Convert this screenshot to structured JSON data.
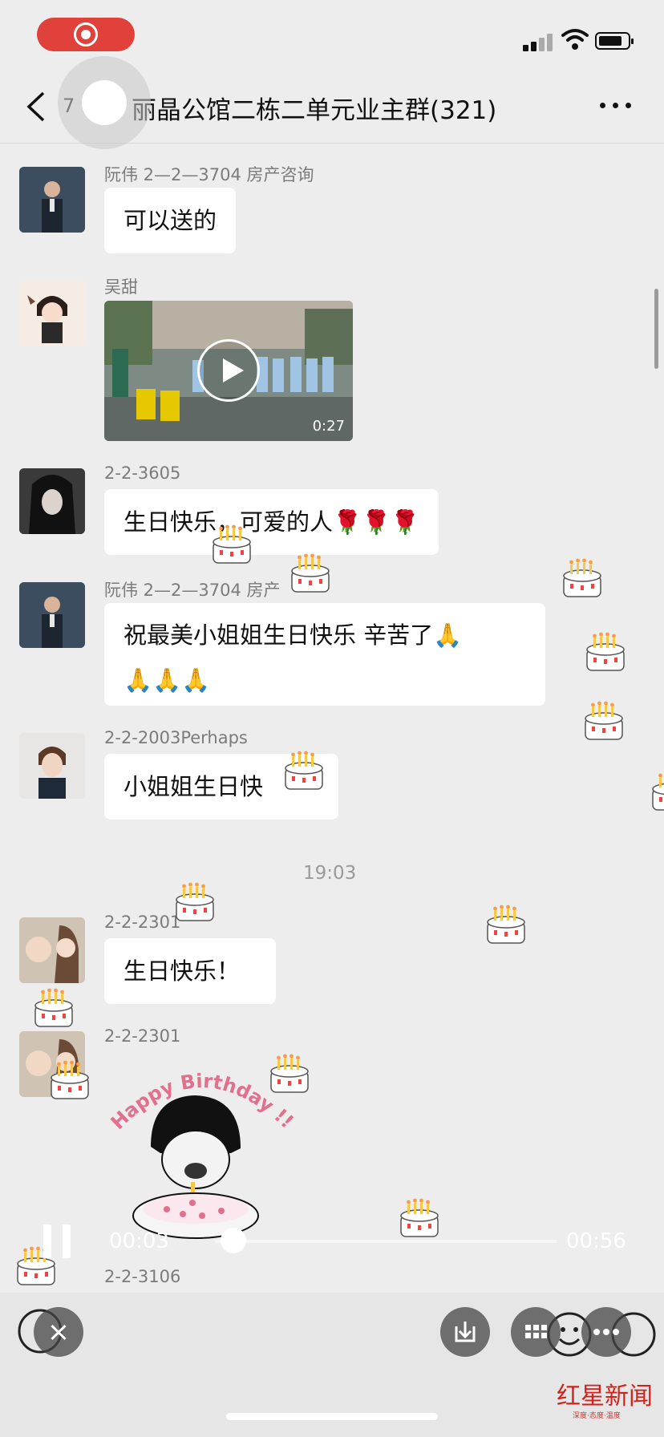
{
  "status_bar": {
    "recording": true
  },
  "header": {
    "back_count": "7",
    "title": "丽晶公馆二栋二单元业主群(321)"
  },
  "messages": [
    {
      "sender": "阮伟 2—2—3704 房产咨询",
      "text": "可以送的"
    },
    {
      "sender": "吴甜",
      "video_duration": "0:27"
    },
    {
      "sender": "2-2-3605",
      "text": "生日快乐，可爱的人🌹🌹🌹"
    },
    {
      "sender": "阮伟 2—2—3704 房产",
      "text_line1": "祝最美小姐姐生日快乐 辛苦了🙏",
      "text_line2": "🙏🙏🙏"
    },
    {
      "sender": "2-2-2003Perhaps",
      "text": "小姐姐生日快"
    },
    {
      "sender": "2-2-2301",
      "text": "生日快乐！"
    },
    {
      "sender": "2-2-2301"
    },
    {
      "sender": "2-2-3106"
    }
  ],
  "timestamp": "19:03",
  "sticker": {
    "text": "Happy Birthday !!"
  },
  "player": {
    "current_time": "00:03",
    "total_time": "00:56",
    "progress": 0.054
  },
  "watermark": {
    "logo": "红星新闻",
    "sub": "深度·态度·温度"
  }
}
